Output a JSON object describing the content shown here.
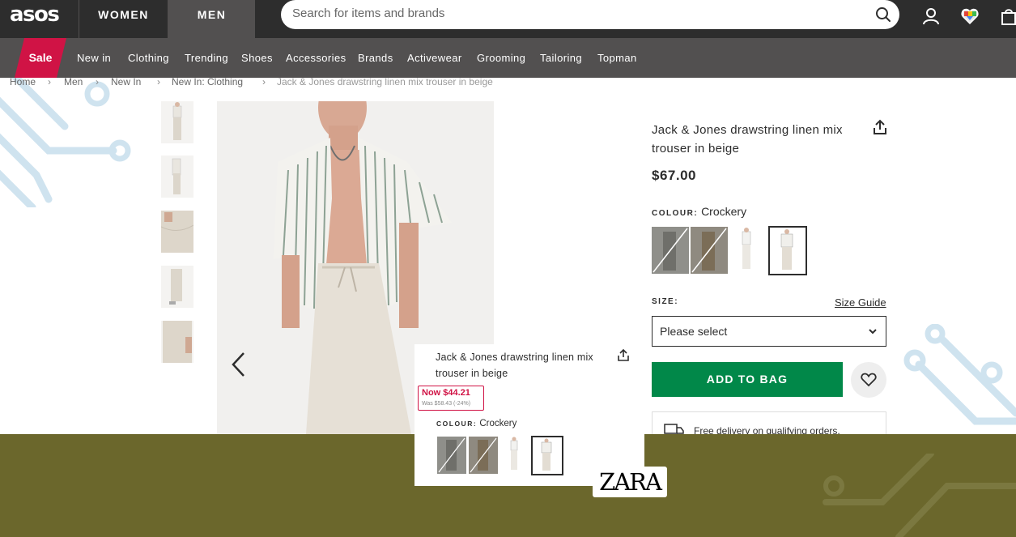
{
  "header": {
    "logo": "asos",
    "tabs": [
      "WOMEN",
      "MEN"
    ],
    "search_placeholder": "Search for items and brands",
    "icons": [
      "account-icon",
      "saved-items-icon",
      "bag-icon"
    ]
  },
  "nav": {
    "sale": "Sale",
    "items": [
      "New in",
      "Clothing",
      "Trending",
      "Shoes",
      "Accessories",
      "Brands",
      "Activewear",
      "Grooming",
      "Tailoring",
      "Topman"
    ]
  },
  "breadcrumb": [
    "Home",
    "Men",
    "New In",
    "New In: Clothing",
    "Jack & Jones drawstring linen mix trouser in beige"
  ],
  "product": {
    "title": "Jack & Jones drawstring linen mix trouser in beige",
    "price": "$67.00",
    "colour_label": "COLOUR:",
    "colour_value": "Crockery",
    "size_label": "SIZE:",
    "size_guide": "Size Guide",
    "size_placeholder": "Please select",
    "add_to_bag": "ADD TO BAG",
    "delivery_text": "Free delivery on qualifying orders."
  },
  "popup": {
    "title": "Jack & Jones drawstring linen mix trouser in beige",
    "now_price": "Now $44.21",
    "was_price": "Was $58.43 (-24%)",
    "colour_label": "COLOUR:",
    "colour_value": "Crockery"
  },
  "ad": {
    "brand": "ZARA"
  },
  "colors": {
    "header_bg": "#2d2d2d",
    "nav_bg": "#525050",
    "sale": "#d01345",
    "add_to_bag": "#018849",
    "olive_band": "#6b672c"
  }
}
